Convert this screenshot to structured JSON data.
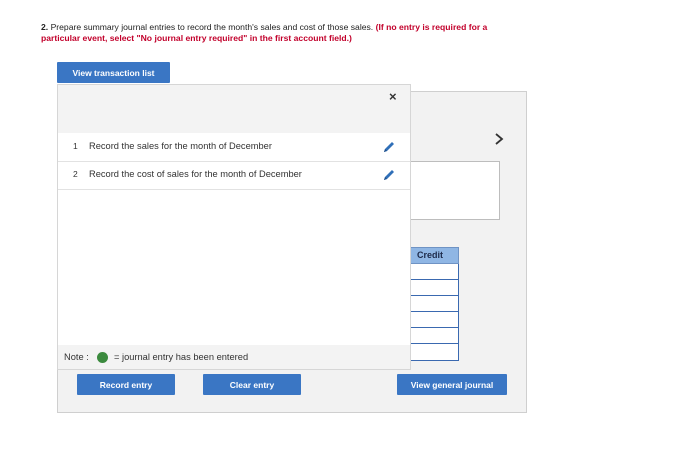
{
  "question": {
    "number": "2.",
    "text": "Prepare summary journal entries to record the month's sales and cost of those sales.",
    "instruction": "(If no entry is required for a particular event, select \"No journal entry required\" in the first account field.)"
  },
  "buttons": {
    "view_transaction_list": "View transaction list",
    "record_entry": "Record entry",
    "clear_entry": "Clear entry",
    "view_general_journal": "View general journal"
  },
  "transaction_list": {
    "close": "×",
    "items": [
      {
        "number": "1",
        "label": "Record the sales for the month of December"
      },
      {
        "number": "2",
        "label": "Record the cost of sales for the month of December"
      }
    ],
    "note_label": "Note :",
    "note_text": "= journal entry has been entered"
  },
  "journal": {
    "credit_header": "Credit",
    "next_arrow": "›"
  },
  "colors": {
    "accent": "#3a76c4",
    "instruction_red": "#c2002b",
    "entered_dot": "#3b8a3e",
    "credit_header": "#8fb6e4"
  }
}
